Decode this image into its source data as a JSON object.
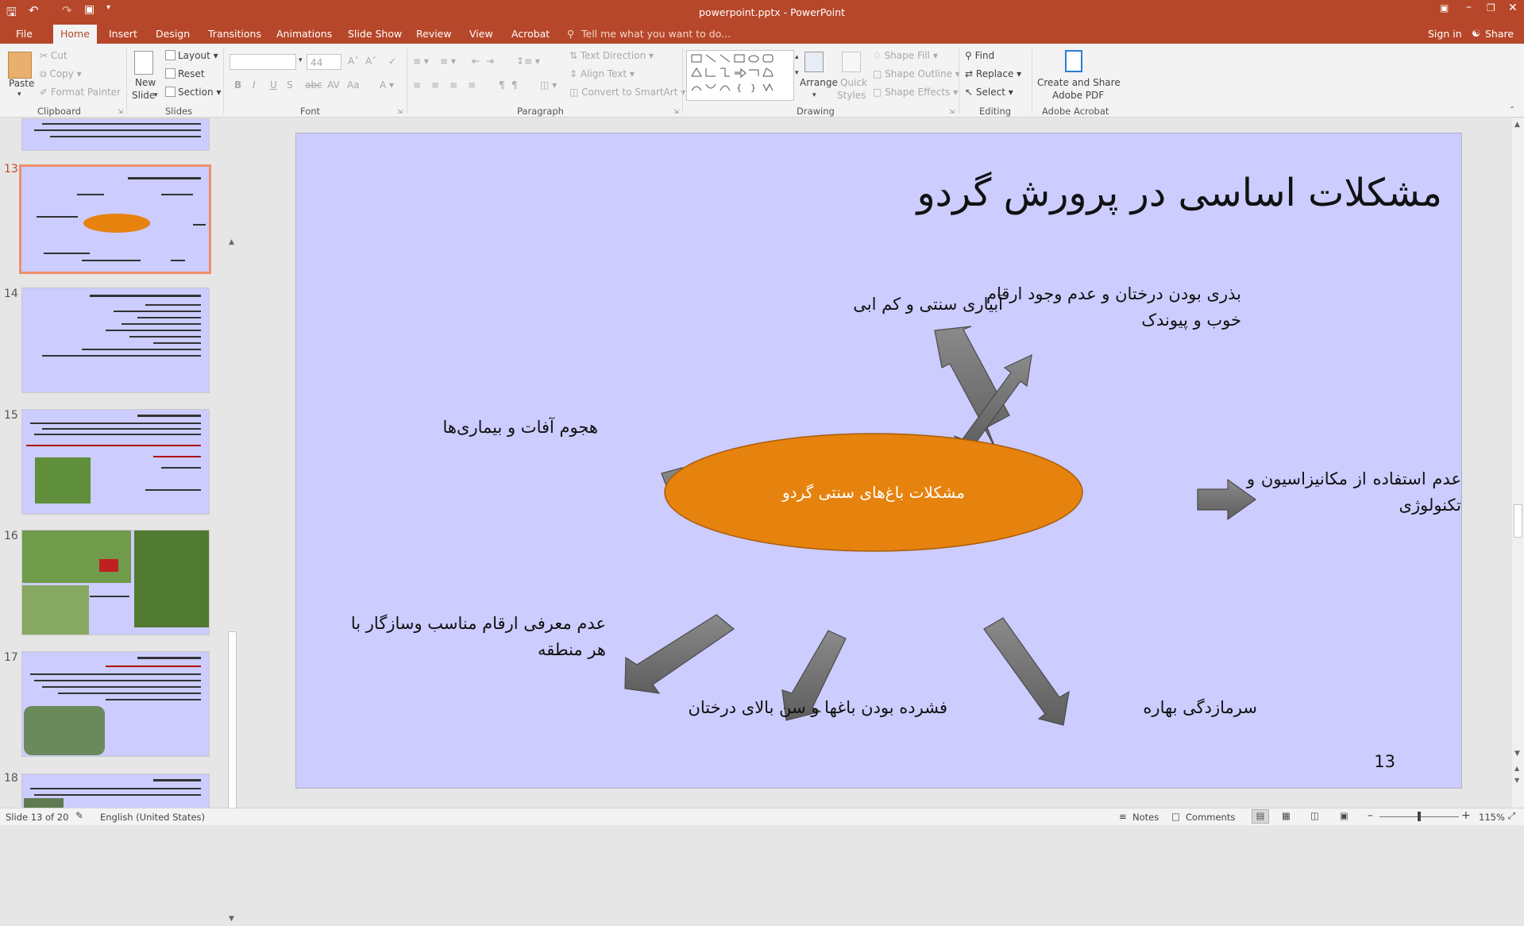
{
  "app": {
    "title": "powerpoint.pptx - PowerPoint"
  },
  "tabs": {
    "file": "File",
    "home": "Home",
    "insert": "Insert",
    "design": "Design",
    "transitions": "Transitions",
    "animations": "Animations",
    "slideshow": "Slide Show",
    "review": "Review",
    "view": "View",
    "acrobat": "Acrobat",
    "tell": "Tell me what you want to do...",
    "signin": "Sign in",
    "share": "Share"
  },
  "ribbon": {
    "clipboard": {
      "paste": "Paste",
      "cut": "Cut",
      "copy": "Copy",
      "format_painter": "Format Painter",
      "label": "Clipboard"
    },
    "slides": {
      "new_slide": "New",
      "new_slide2": "Slide",
      "layout": "Layout",
      "reset": "Reset",
      "section": "Section",
      "label": "Slides"
    },
    "font": {
      "size": "44",
      "label": "Font",
      "b": "B",
      "i": "I",
      "u": "U",
      "s": "S",
      "aa": "Aa"
    },
    "paragraph": {
      "text_direction": "Text Direction",
      "align_text": "Align Text",
      "smartart": "Convert to SmartArt",
      "label": "Paragraph"
    },
    "drawing": {
      "arrange": "Arrange",
      "quick": "Quick",
      "styles": "Styles",
      "shape_fill": "Shape Fill",
      "shape_outline": "Shape Outline",
      "shape_effects": "Shape Effects",
      "label": "Drawing"
    },
    "editing": {
      "find": "Find",
      "replace": "Replace",
      "select": "Select",
      "label": "Editing"
    },
    "acrobat": {
      "create1": "Create and Share",
      "create2": "Adobe PDF",
      "label": "Adobe Acrobat"
    }
  },
  "thumbnails": [
    {
      "num": "13"
    },
    {
      "num": "14"
    },
    {
      "num": "15"
    },
    {
      "num": "16"
    },
    {
      "num": "17"
    },
    {
      "num": "18"
    }
  ],
  "slide": {
    "title": "مشکلات اساسی در پرورش گردو",
    "center": "مشکلات باغ‌های سنتی گردو",
    "items": {
      "seed_trees": "بذری بودن درختان و عدم وجود ارقام خوب و پیوندک",
      "irrigation": "آبیاری سنتی و کم ابی",
      "pests": "هجوم آفات و بیماری‌ها",
      "mechanization": "عدم استفاده از مکانیزاسیون و تکنولوژی",
      "varieties": "عدم معرفی ارقام مناسب وسازگار با هر منطقه",
      "density": "فشرده بودن باغها و سن بالای درختان",
      "frost": "سرمازدگی بهاره"
    },
    "page_number": "13"
  },
  "status": {
    "slide_info": "Slide 13 of 20",
    "language": "English (United States)",
    "notes": "Notes",
    "comments": "Comments",
    "zoom": "115%"
  },
  "colors": {
    "accent": "#b7472a",
    "slide_bg": "#ccccff",
    "ellipse": "#e6820e",
    "arrow": "#808080"
  }
}
